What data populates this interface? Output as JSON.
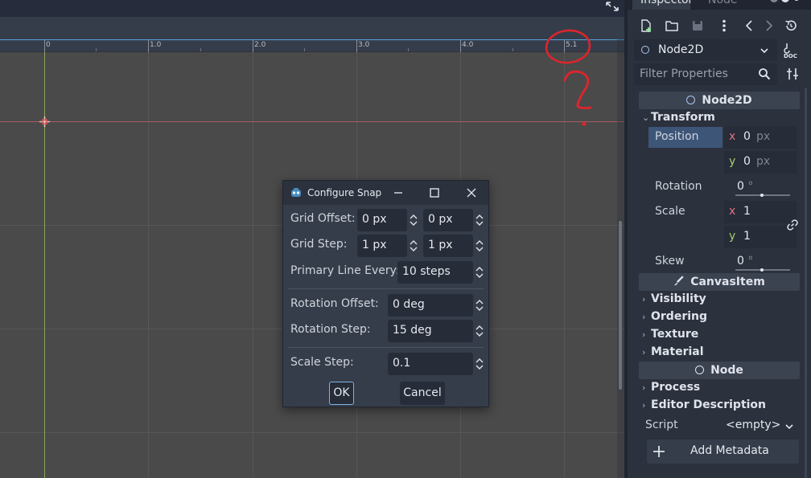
{
  "ruler": {
    "labels": [
      "0",
      "1.0",
      "2.0",
      "3.0",
      "4.0",
      "5.1"
    ]
  },
  "dialog": {
    "title": "Configure Snap",
    "grid_offset": {
      "label": "Grid Offset:",
      "x": "0 px",
      "y": "0 px"
    },
    "grid_step": {
      "label": "Grid Step:",
      "x": "1 px",
      "y": "1 px"
    },
    "primary_line": {
      "label": "Primary Line Every:",
      "value": "10 steps"
    },
    "rotation_offset": {
      "label": "Rotation Offset:",
      "value": "0 deg"
    },
    "rotation_step": {
      "label": "Rotation Step:",
      "value": "15 deg"
    },
    "scale_step": {
      "label": "Scale Step:",
      "value": "0.1"
    },
    "ok_label": "OK",
    "cancel_label": "Cancel"
  },
  "inspector": {
    "tabs": [
      "Inspector",
      "Node"
    ],
    "node_selector": "Node2D",
    "filter_placeholder": "Filter Properties",
    "sections": {
      "node2d": "Node2D",
      "canvasitem": "CanvasItem",
      "node": "Node"
    },
    "transform": {
      "label": "Transform",
      "position": {
        "label": "Position",
        "x": "0",
        "y": "0",
        "unit": "px"
      },
      "rotation": {
        "label": "Rotation",
        "value": "0",
        "unit": "°"
      },
      "scale": {
        "label": "Scale",
        "x": "1",
        "y": "1"
      },
      "skew": {
        "label": "Skew",
        "value": "0",
        "unit": "°"
      }
    },
    "canvasitem_categories": [
      "Visibility",
      "Ordering",
      "Texture",
      "Material"
    ],
    "node_categories": [
      "Process",
      "Editor Description"
    ],
    "script": {
      "label": "Script",
      "value": "<empty>"
    },
    "add_metadata": "Add Metadata"
  },
  "colors": {
    "accent": "#57a5e0",
    "axis_x_color": "#e0727e",
    "axis_y_color": "#a6cc70",
    "annotation": "#e0242b",
    "panel_bg": "#2b313d"
  }
}
